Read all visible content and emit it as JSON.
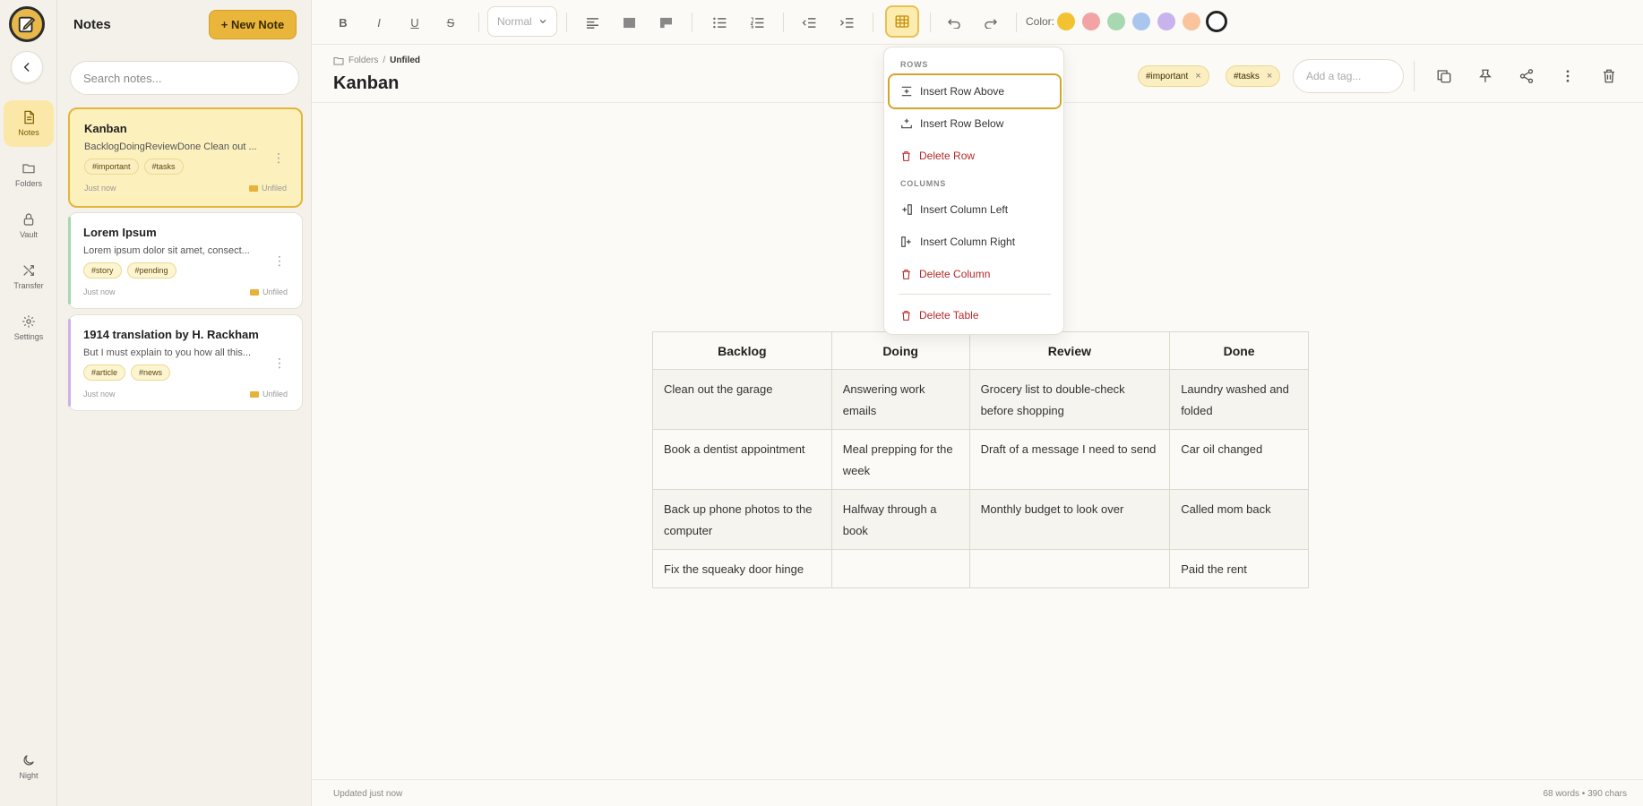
{
  "rail": {
    "items": [
      {
        "label": "Notes",
        "icon": "note-icon"
      },
      {
        "label": "Folders",
        "icon": "folder-icon"
      },
      {
        "label": "Vault",
        "icon": "lock-icon"
      },
      {
        "label": "Transfer",
        "icon": "shuffle-icon"
      },
      {
        "label": "Settings",
        "icon": "gear-icon"
      }
    ],
    "night_label": "Night"
  },
  "notes_panel": {
    "title": "Notes",
    "new_note_label": "+ New Note",
    "search_placeholder": "Search notes..."
  },
  "notes": [
    {
      "title": "Kanban",
      "preview": "BacklogDoingReviewDone Clean out ...",
      "tags": [
        "#important",
        "#tasks"
      ],
      "time": "Just now",
      "folder": "Unfiled"
    },
    {
      "title": "Lorem Ipsum",
      "preview": "Lorem ipsum dolor sit amet, consect...",
      "tags": [
        "#story",
        "#pending"
      ],
      "time": "Just now",
      "folder": "Unfiled"
    },
    {
      "title": "1914 translation by H. Rackham",
      "preview": "But I must explain to you how all this...",
      "tags": [
        "#article",
        "#news"
      ],
      "time": "Just now",
      "folder": "Unfiled"
    }
  ],
  "toolbar": {
    "bold": "B",
    "italic": "I",
    "underline": "U",
    "strike": "S",
    "format_value": "Normal",
    "color_label": "Color:",
    "swatches": [
      "#f2c230",
      "#f3a3a3",
      "#a8d8b0",
      "#a9c6ef",
      "#c9b3ec",
      "#f9c39b",
      "#ffffff"
    ]
  },
  "note": {
    "breadcrumb_root": "Folders",
    "breadcrumb_sep": "/",
    "breadcrumb_current": "Unfiled",
    "title": "Kanban",
    "tags": [
      "#important",
      "#tasks"
    ],
    "tag_remove": "×",
    "add_tag_placeholder": "Add a tag..."
  },
  "table_menu": {
    "rows_heading": "ROWS",
    "insert_row_above": "Insert Row Above",
    "insert_row_below": "Insert Row Below",
    "delete_row": "Delete Row",
    "columns_heading": "COLUMNS",
    "insert_col_left": "Insert Column Left",
    "insert_col_right": "Insert Column Right",
    "delete_col": "Delete Column",
    "delete_table": "Delete Table"
  },
  "table": {
    "headers": [
      "Backlog",
      "Doing",
      "Review",
      "Done"
    ],
    "rows": [
      [
        "Clean out the garage",
        "Answering work emails",
        "Grocery list to double-check before shopping",
        "Laundry washed and folded"
      ],
      [
        "Book a dentist appointment",
        "Meal prepping for the week",
        "Draft of a message I need to send",
        "Car oil changed"
      ],
      [
        "Back up phone photos to the computer",
        "Halfway through a book",
        "Monthly budget to look over",
        "Called mom back"
      ],
      [
        "Fix the squeaky door hinge",
        "",
        "",
        "Paid the rent"
      ]
    ]
  },
  "footer": {
    "updated": "Updated just now",
    "stats": "68 words • 390 chars"
  }
}
